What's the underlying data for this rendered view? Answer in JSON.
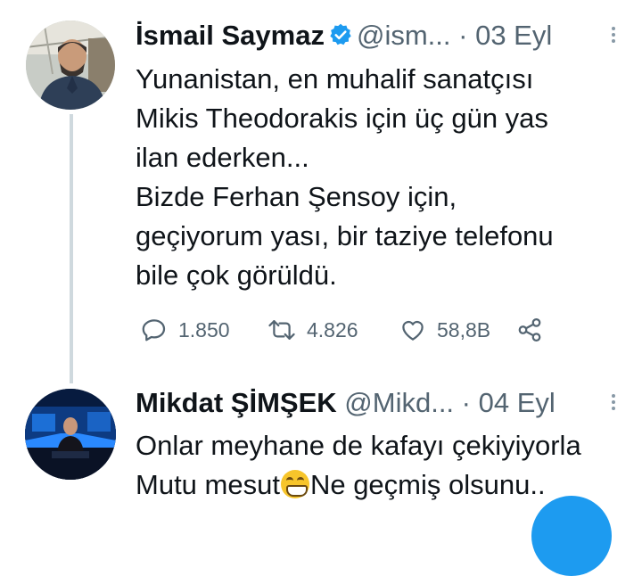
{
  "thread": {
    "tweets": [
      {
        "display_name": "İsmail Saymaz",
        "handle": "@ism...",
        "separator": "·",
        "date": "03 Eyl",
        "verified": true,
        "avatar_icon": "person-photo-icon",
        "text_lines": [
          "Yunanistan, en muhalif sanatçısı",
          "Mikis Theodorakis için üç gün yas",
          "ilan ederken...",
          "Bizde Ferhan Şensoy için,",
          "geçiyorum yası, bir taziye telefonu",
          "bile çok görüldü."
        ],
        "actions": {
          "replies": "1.850",
          "retweets": "4.826",
          "likes": "58,8B"
        }
      },
      {
        "display_name": "Mikdat ŞİMŞEK",
        "handle": "@Mikd...",
        "separator": "·",
        "date": "04 Eyl",
        "avatar_icon": "tv-studio-photo-icon",
        "text_line1": "Onlar meyhane de kafayı çekiyiyorla",
        "text_line2_before": "Mutu mesut",
        "emoji": "grinning-face-emoji",
        "text_line2_after": "Ne geçmiş olsunu.."
      }
    ]
  },
  "colors": {
    "accent": "#1d9bf0",
    "text_primary": "#0f1419",
    "text_secondary": "#536471",
    "thread_line": "#cfd9de"
  }
}
